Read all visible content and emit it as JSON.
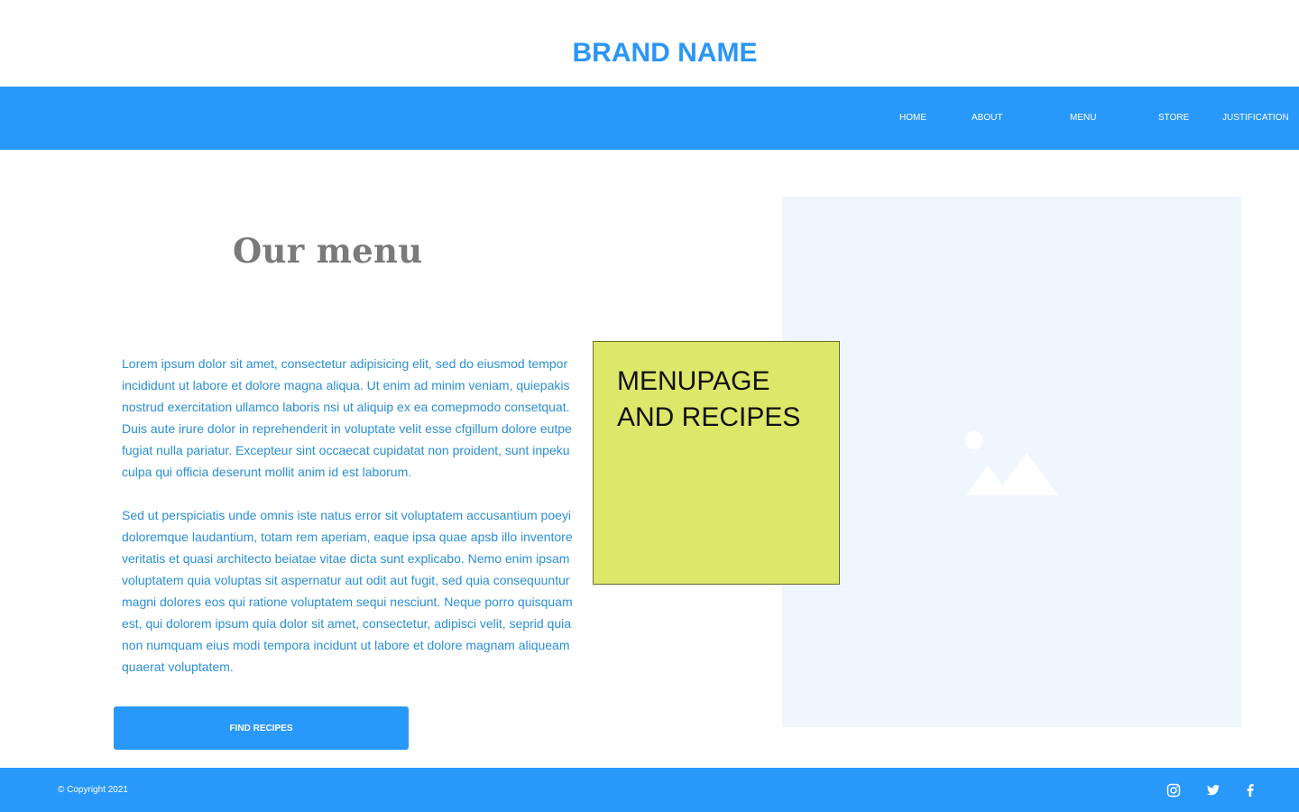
{
  "header": {
    "brand_name": "BRAND NAME"
  },
  "nav": {
    "items": [
      {
        "label": "HOME"
      },
      {
        "label": "ABOUT"
      },
      {
        "label": "MENU"
      },
      {
        "label": "STORE"
      },
      {
        "label": "JUSTIFICATION"
      }
    ]
  },
  "main": {
    "title": "Our menu",
    "paragraph_1": "Lorem ipsum dolor sit amet, consectetur adipisicing elit, sed do eiusmod tempor incididunt ut labore et dolore magna aliqua. Ut enim ad minim veniam, quiepakis nostrud exercitation ullamco laboris nsi ut aliquip ex ea comepmodo consetquat. Duis aute irure dolor in reprehenderit in voluptate velit esse cfgillum dolore eutpe fugiat nulla pariatur. Excepteur sint occaecat cupidatat non proident, sunt inpeku culpa qui officia deserunt mollit anim id est laborum.",
    "paragraph_2": "Sed ut perspiciatis unde omnis iste natus error sit voluptatem accusantium poeyi doloremque laudantium, totam rem aperiam, eaque ipsa quae apsb illo inventore veritatis et quasi architecto beiatae vitae dicta sunt explicabo. Nemo enim ipsam voluptatem quia voluptas sit aspernatur aut odit aut fugit, sed quia consequuntur magni dolores eos qui ratione voluptatem sequi nesciunt. Neque porro quisquam est, qui dolorem ipsum quia dolor sit amet, consectetur, adipisci velit, seprid quia non numquam eius modi tempora incidunt ut labore et dolore magnam aliqueam quaerat voluptatem.",
    "button_label": "FIND RECIPES",
    "image_placeholder_icon": "image-icon"
  },
  "sticky_note": {
    "text": "MENUPAGE AND RECIPES"
  },
  "footer": {
    "copyright": "© Copyright 2021",
    "social_icons": [
      "instagram-icon",
      "twitter-icon",
      "facebook-icon"
    ]
  },
  "colors": {
    "brand": "#2a96f5",
    "nav_background": "#2998fb",
    "body_text": "#2a8fd6",
    "heading": "#7a7a7a",
    "image_panel": "#eff6fe",
    "sticky_note": "#dde769"
  }
}
